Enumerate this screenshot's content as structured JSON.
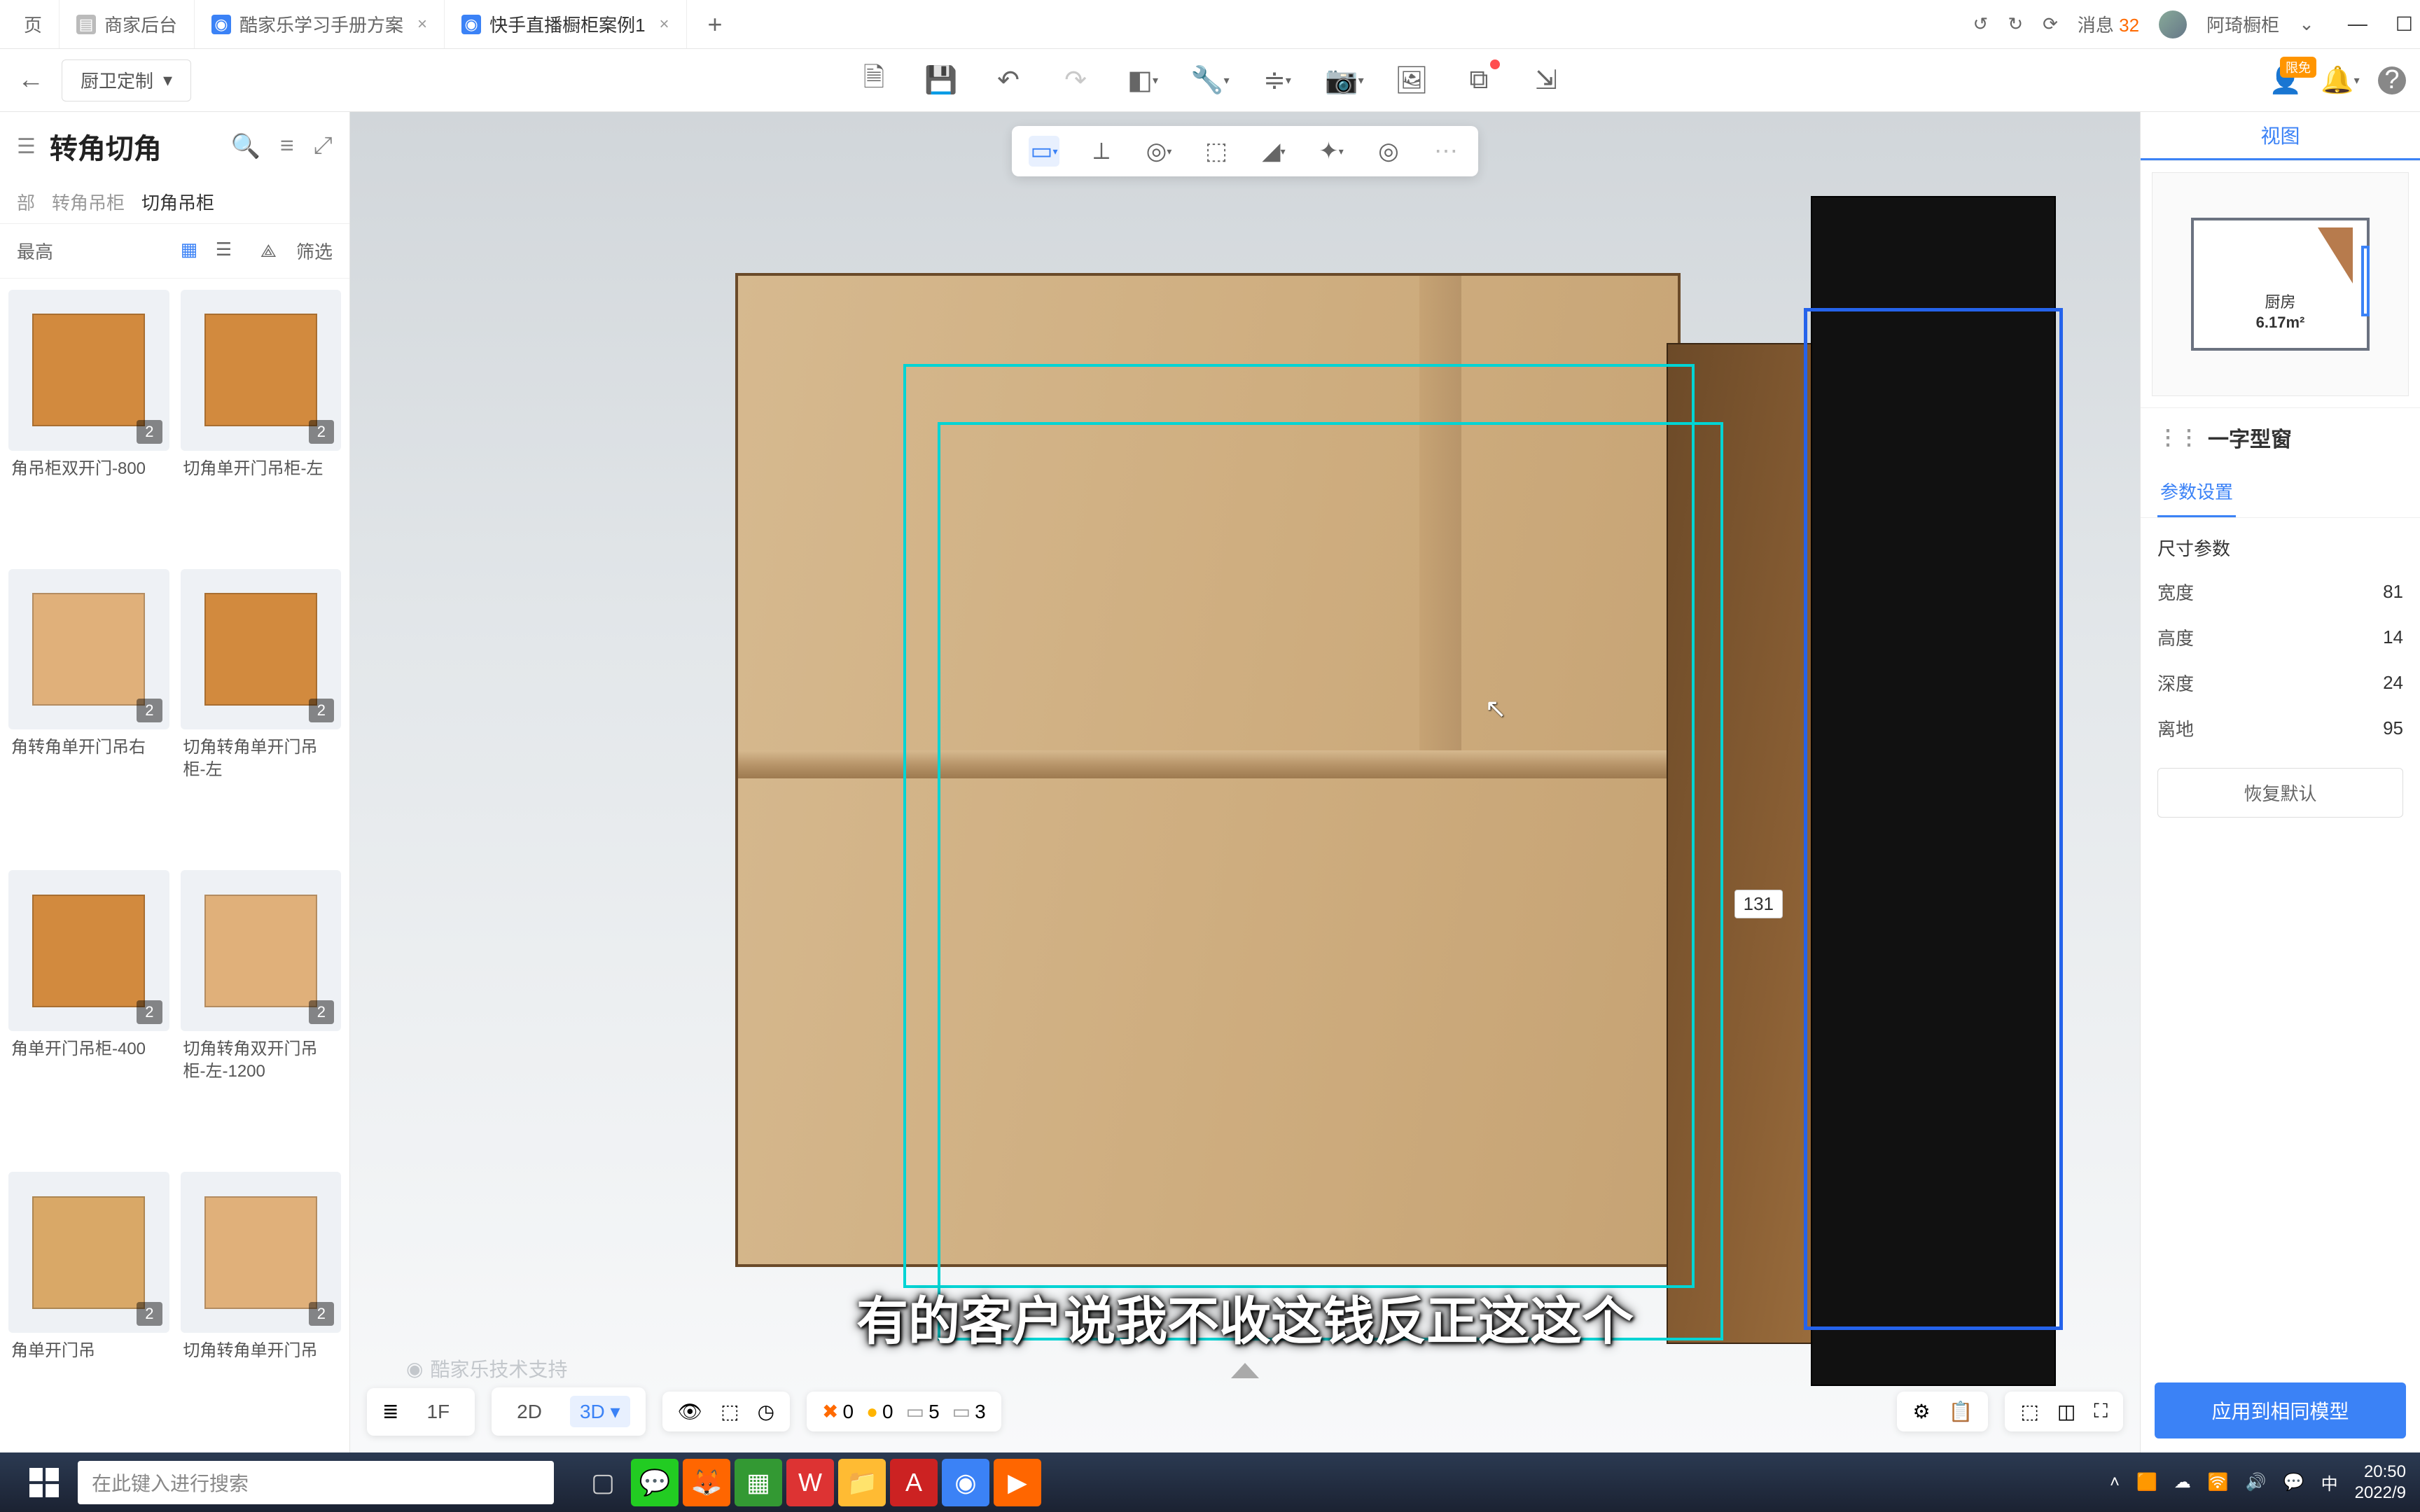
{
  "titlebar": {
    "tabs": [
      {
        "icon_bg": "#999",
        "label": "页"
      },
      {
        "icon_bg": "#999",
        "label": "商家后台"
      },
      {
        "icon_bg": "#3b82f6",
        "label": "酷家乐学习手册方案"
      },
      {
        "icon_bg": "#3b82f6",
        "label": "快手直播橱柜案例1",
        "active": true
      }
    ],
    "messages_label": "消息",
    "messages_count": "32",
    "username": "阿琦橱柜"
  },
  "toolbar": {
    "mode_label": "厨卫定制",
    "back_icon": "←",
    "badge_text": "限免"
  },
  "sidebar": {
    "title": "转角切角",
    "breadcrumb": [
      "部",
      "转角吊柜",
      "切角吊柜"
    ],
    "sort_label": "最高",
    "filter_label": "筛选",
    "items": [
      {
        "label": "角吊柜双开门-800",
        "badge": "2",
        "color": "#d28a3e"
      },
      {
        "label": "切角单开门吊柜-左",
        "badge": "2",
        "color": "#d28a3e"
      },
      {
        "label": "角转角单开门吊右",
        "badge": "2",
        "color": "#e0b07a"
      },
      {
        "label": "切角转角单开门吊柜-左",
        "badge": "2",
        "color": "#d28a3e"
      },
      {
        "label": "角单开门吊柜-400",
        "badge": "2",
        "color": "#d28a3e"
      },
      {
        "label": "切角转角双开门吊柜-左-1200",
        "badge": "2",
        "color": "#e0b07a"
      },
      {
        "label": "角单开门吊",
        "badge": "2",
        "color": "#d9a867"
      },
      {
        "label": "切角转角单开门吊",
        "badge": "2",
        "color": "#e0b07a"
      }
    ]
  },
  "viewport": {
    "dim_label": "131",
    "watermark": "酷家乐技术支持",
    "subtitle": "有的客户说我不收这钱反正这这个",
    "bottom": {
      "floor": "1F",
      "mode_2d": "2D",
      "mode_3d": "3D",
      "status_x": "0",
      "status_o": "0",
      "status_g": "5",
      "status_b": "3"
    }
  },
  "rightpanel": {
    "tab_view": "视图",
    "floorplan_room": "厨房",
    "floorplan_area": "6.17m²",
    "section_title": "一字型窗",
    "subtab_params": "参数设置",
    "group_size": "尺寸参数",
    "params": [
      {
        "label": "宽度",
        "value": "81"
      },
      {
        "label": "高度",
        "value": "14"
      },
      {
        "label": "深度",
        "value": "24"
      },
      {
        "label": "离地",
        "value": "95"
      }
    ],
    "restore": "恢复默认",
    "apply": "应用到相同模型"
  },
  "taskbar": {
    "search_placeholder": "在此键入进行搜索",
    "ime": "中",
    "time": "20:50",
    "date": "2022/9"
  },
  "icons": {
    "search": "🔍",
    "sort": "≡",
    "expand": "⤢",
    "grid": "▦",
    "list": "☰",
    "filter": "⟁",
    "save": "🗎",
    "open": "🗀",
    "undo": "↶",
    "redo": "↷",
    "eraser": "◧",
    "wrench": "🔧",
    "axis": "✛",
    "camera": "📷",
    "image": "🖼",
    "copy": "⧉",
    "export": "⇲",
    "user": "👤",
    "bell": "🔔",
    "help": "?",
    "layers": "≣",
    "eye": "👁",
    "cube": "⬚",
    "gauge": "◷",
    "clipboard": "📋",
    "target": "⌖",
    "fullscreen": "⛶",
    "measure": "📐",
    "globe": "🌐",
    "scan": "⬚",
    "highlight": "◢",
    "puzzle": "✦",
    "ring": "◎",
    "chevron": "▾",
    "dots": "⋮"
  }
}
